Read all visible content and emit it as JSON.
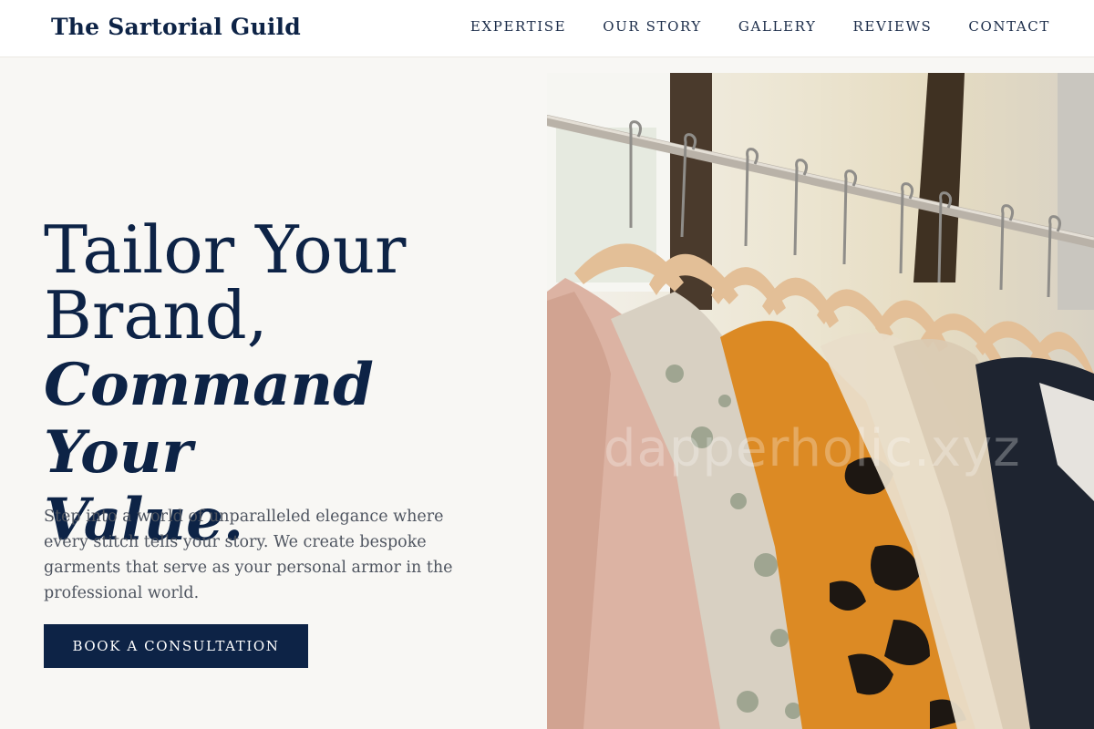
{
  "brand": {
    "name": "The Sartorial Guild"
  },
  "nav": {
    "items": [
      {
        "label": "EXPERTISE"
      },
      {
        "label": "OUR STORY"
      },
      {
        "label": "GALLERY"
      },
      {
        "label": "REVIEWS"
      },
      {
        "label": "CONTACT"
      }
    ]
  },
  "hero": {
    "headline_line1": "Tailor Your",
    "headline_line2": "Brand,",
    "headline_italic1": "Command Your",
    "headline_italic2": "Value.",
    "lede": "Step into a world of unparalleled elegance where every stitch tells your story. We create bespoke garments that serve as your personal armor in the professional world.",
    "cta_label": "BOOK A CONSULTATION"
  },
  "image": {
    "subject": "clothing-rack-photo",
    "watermark": "dapperholic.xyz"
  },
  "colors": {
    "navy": "#0d2346",
    "background": "#f8f7f4",
    "body_text": "#4f5560",
    "mustard": "#dc8a24"
  }
}
